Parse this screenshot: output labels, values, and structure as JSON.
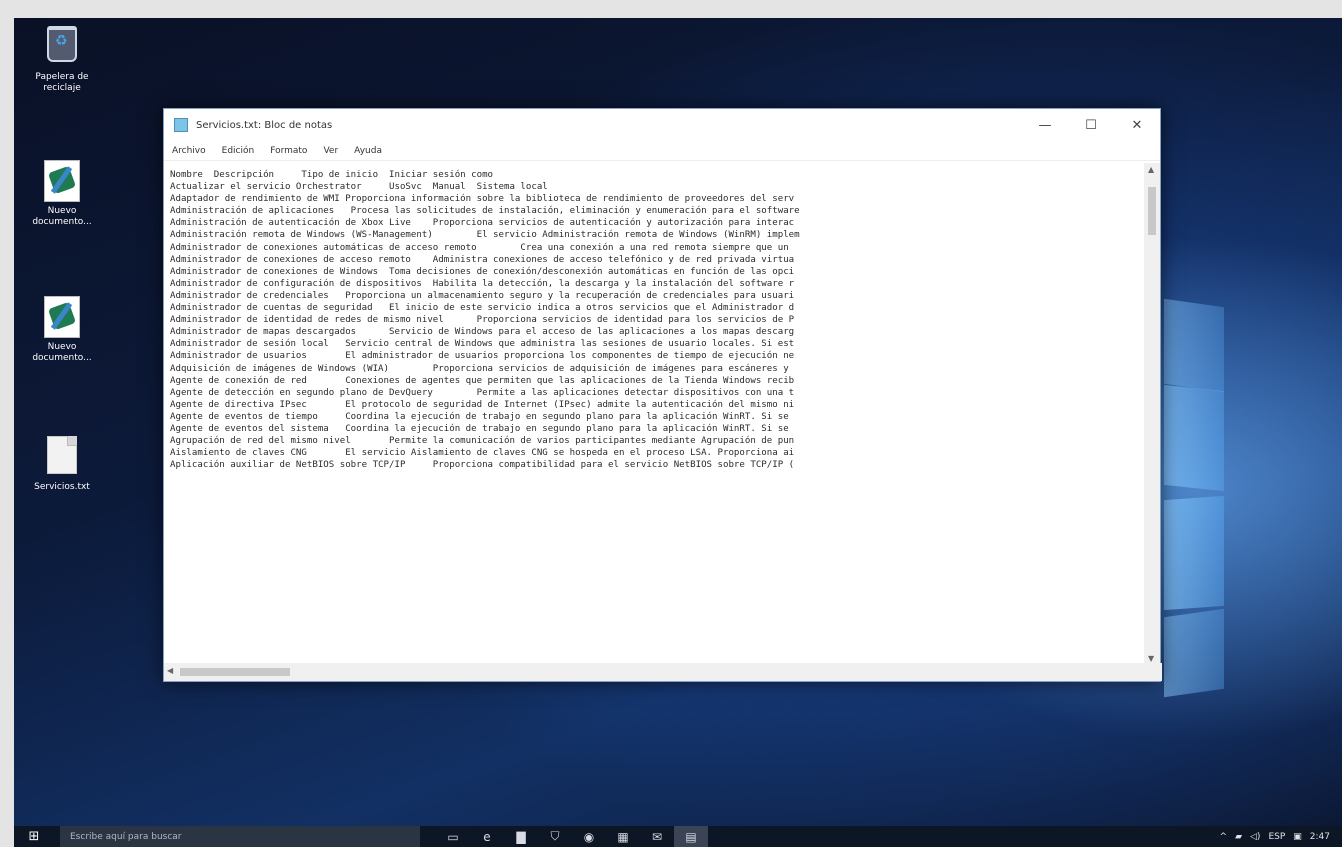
{
  "desktop_icons": [
    {
      "icon": "recycle-bin-icon",
      "label": "Papelera de reciclaje"
    },
    {
      "icon": "document-icon",
      "label": "Nuevo documento..."
    },
    {
      "icon": "document-icon",
      "label": "Nuevo documento..."
    },
    {
      "icon": "text-file-icon",
      "label": "Servicios.txt"
    }
  ],
  "window": {
    "title": "Servicios.txt: Bloc de notas",
    "controls": {
      "minimize": "—",
      "maximize": "☐",
      "close": "✕"
    },
    "menu": [
      "Archivo",
      "Edición",
      "Formato",
      "Ver",
      "Ayuda"
    ],
    "lines": [
      "Nombre  Descripción     Tipo de inicio  Iniciar sesión como",
      "Actualizar el servicio Orchestrator     UsoSvc  Manual  Sistema local",
      "Adaptador de rendimiento de WMI Proporciona información sobre la biblioteca de rendimiento de proveedores del serv",
      "Administración de aplicaciones   Procesa las solicitudes de instalación, eliminación y enumeración para el software",
      "Administración de autenticación de Xbox Live    Proporciona servicios de autenticación y autorización para interac",
      "Administración remota de Windows (WS-Management)        El servicio Administración remota de Windows (WinRM) implem",
      "Administrador de conexiones automáticas de acceso remoto        Crea una conexión a una red remota siempre que un",
      "Administrador de conexiones de acceso remoto    Administra conexiones de acceso telefónico y de red privada virtua",
      "Administrador de conexiones de Windows  Toma decisiones de conexión/desconexión automáticas en función de las opci",
      "Administrador de configuración de dispositivos  Habilita la detección, la descarga y la instalación del software r",
      "Administrador de credenciales   Proporciona un almacenamiento seguro y la recuperación de credenciales para usuari",
      "Administrador de cuentas de seguridad   El inicio de este servicio indica a otros servicios que el Administrador d",
      "Administrador de identidad de redes de mismo nivel      Proporciona servicios de identidad para los servicios de P",
      "Administrador de mapas descargados      Servicio de Windows para el acceso de las aplicaciones a los mapas descarg",
      "Administrador de sesión local   Servicio central de Windows que administra las sesiones de usuario locales. Si est",
      "Administrador de usuarios       El administrador de usuarios proporciona los componentes de tiempo de ejecución ne",
      "Adquisición de imágenes de Windows (WIA)        Proporciona servicios de adquisición de imágenes para escáneres y",
      "Agente de conexión de red       Conexiones de agentes que permiten que las aplicaciones de la Tienda Windows recib",
      "Agente de detección en segundo plano de DevQuery        Permite a las aplicaciones detectar dispositivos con una t",
      "Agente de directiva IPsec       El protocolo de seguridad de Internet (IPsec) admite la autenticación del mismo ni",
      "Agente de eventos de tiempo     Coordina la ejecución de trabajo en segundo plano para la aplicación WinRT. Si se",
      "Agente de eventos del sistema   Coordina la ejecución de trabajo en segundo plano para la aplicación WinRT. Si se",
      "Agrupación de red del mismo nivel       Permite la comunicación de varios participantes mediante Agrupación de pun",
      "Aislamiento de claves CNG       El servicio Aislamiento de claves CNG se hospeda en el proceso LSA. Proporciona ai",
      "Aplicación auxiliar de NetBIOS sobre TCP/IP     Proporciona compatibilidad para el servicio NetBIOS sobre TCP/IP ("
    ]
  },
  "taskbar": {
    "start": "⊞",
    "search_placeholder": "Escribe aquí para buscar",
    "apps": [
      {
        "icon": "task-view-icon",
        "glyph": "▭"
      },
      {
        "icon": "edge-icon",
        "glyph": "e"
      },
      {
        "icon": "file-explorer-icon",
        "glyph": "▇"
      },
      {
        "icon": "store-icon",
        "glyph": "⛉"
      },
      {
        "icon": "chrome-icon",
        "glyph": "◉"
      },
      {
        "icon": "calculator-icon",
        "glyph": "▦"
      },
      {
        "icon": "mail-icon",
        "glyph": "✉"
      },
      {
        "icon": "notepad-icon",
        "glyph": "▤"
      }
    ],
    "tray": {
      "chevron": "^",
      "network": "▰",
      "volume": "◁)",
      "lang": "ESP",
      "notifications": "▣",
      "time": "2:47"
    }
  }
}
